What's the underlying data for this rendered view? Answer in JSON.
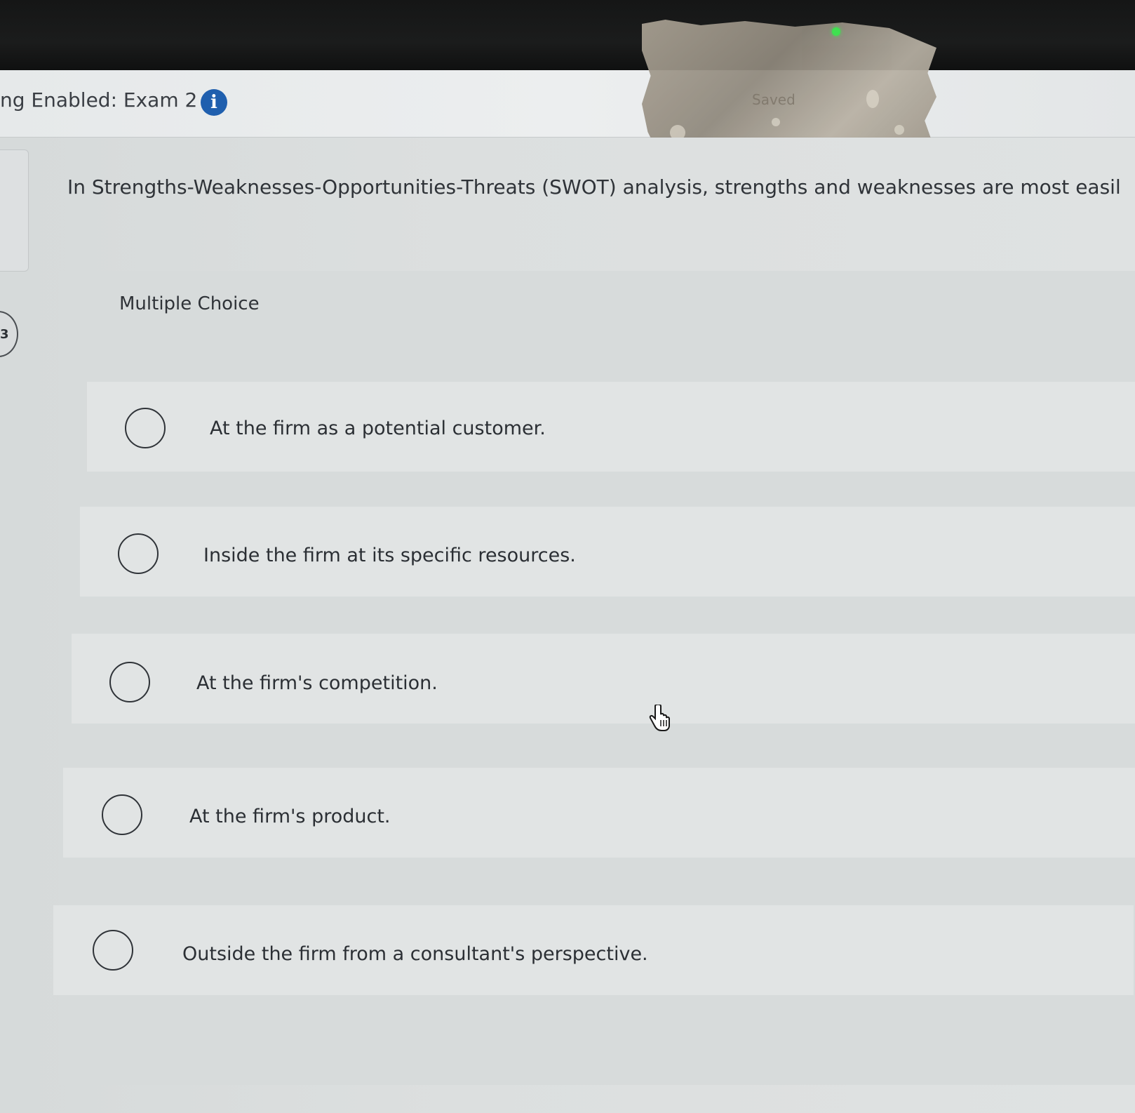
{
  "header": {
    "title": "ng Enabled: Exam 2",
    "info_icon": "info-icon",
    "status": "Saved"
  },
  "question": {
    "text": "In Strengths-Weaknesses-Opportunities-Threats (SWOT) analysis, strengths and weaknesses are most easil",
    "type_label": "Multiple Choice",
    "options": [
      "At the firm as a potential customer.",
      "Inside the firm at its specific resources.",
      "At the firm's competition.",
      "At the firm's product.",
      "Outside the firm from a consultant's perspective."
    ]
  },
  "side_nav": {
    "label": "3"
  },
  "colors": {
    "info_blue": "#1f5fae",
    "background": "#dcdfdf"
  }
}
